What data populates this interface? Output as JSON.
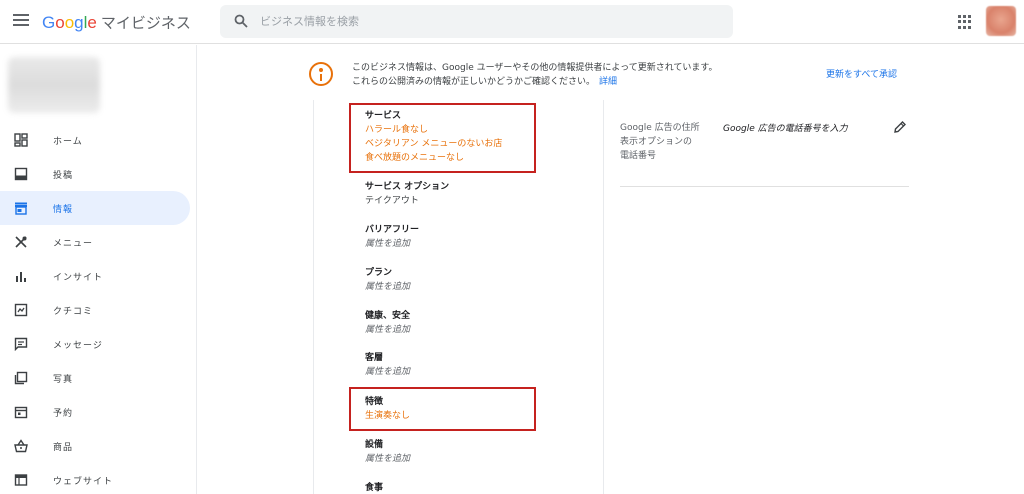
{
  "header": {
    "logo_google": "Google",
    "product": "マイビジネス",
    "search_placeholder": "ビジネス情報を検索"
  },
  "sidebar": {
    "items": [
      {
        "label": "ホーム",
        "icon": "home-grid-icon"
      },
      {
        "label": "投稿",
        "icon": "posts-icon"
      },
      {
        "label": "情報",
        "icon": "storefront-icon",
        "active": true
      },
      {
        "label": "メニュー",
        "icon": "utensils-icon"
      },
      {
        "label": "インサイト",
        "icon": "bar-chart-icon"
      },
      {
        "label": "クチコミ",
        "icon": "reviews-icon"
      },
      {
        "label": "メッセージ",
        "icon": "message-icon"
      },
      {
        "label": "写真",
        "icon": "photos-icon"
      },
      {
        "label": "予約",
        "icon": "calendar-icon"
      },
      {
        "label": "商品",
        "icon": "basket-icon"
      },
      {
        "label": "ウェブサイト",
        "icon": "website-icon"
      }
    ]
  },
  "notice": {
    "line1": "このビジネス情報は、Google ユーザーやその他の情報提供者によって更新されています。",
    "line2": "これらの公開済みの情報が正しいかどうかご確認ください。",
    "details_link": "詳細",
    "approve_all": "更新をすべて承認"
  },
  "attributes": [
    {
      "title": "サービス",
      "values": [
        "ハラール食なし",
        "ベジタリアン メニューのないお店",
        "食べ放題のメニューなし"
      ],
      "style": "orange"
    },
    {
      "title": "サービス オプション",
      "values": [
        "テイクアウト"
      ],
      "style": "normal"
    },
    {
      "title": "バリアフリー",
      "values": [
        "属性を追加"
      ],
      "style": "italic"
    },
    {
      "title": "プラン",
      "values": [
        "属性を追加"
      ],
      "style": "italic"
    },
    {
      "title": "健康、安全",
      "values": [
        "属性を追加"
      ],
      "style": "italic"
    },
    {
      "title": "客層",
      "values": [
        "属性を追加"
      ],
      "style": "italic"
    },
    {
      "title": "特徴",
      "values": [
        "生演奏なし"
      ],
      "style": "orange"
    },
    {
      "title": "設備",
      "values": [
        "属性を追加"
      ],
      "style": "italic"
    },
    {
      "title": "食事",
      "values": [],
      "style": "italic"
    }
  ],
  "right_panel": {
    "label_line1": "Google 広告の住所",
    "label_line2": "表示オプションの",
    "label_line3": "電話番号",
    "value": "Google 広告の電話番号を入力"
  },
  "colors": {
    "accent": "#1a73e8",
    "orange": "#e8710a",
    "highlight": "#c5221f"
  }
}
